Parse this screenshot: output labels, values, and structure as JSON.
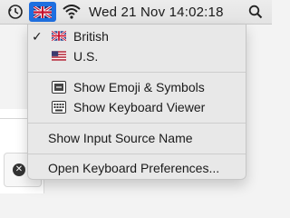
{
  "menubar": {
    "clock_text": "Wed 21 Nov  14:02:18",
    "icons": [
      "time-machine-icon",
      "british-flag-icon",
      "wifi-icon",
      "search-icon"
    ]
  },
  "menu": {
    "sources": [
      {
        "label": "British",
        "checked": true,
        "icon": "british-flag-icon"
      },
      {
        "label": "U.S.",
        "checked": false,
        "icon": "us-flag-icon"
      }
    ],
    "viewers": [
      {
        "label": "Show Emoji & Symbols",
        "icon": "emoji-viewer-icon"
      },
      {
        "label": "Show Keyboard Viewer",
        "icon": "keyboard-viewer-icon"
      }
    ],
    "show_source_name": "Show Input Source Name",
    "open_prefs": "Open Keyboard Preferences..."
  },
  "colors": {
    "menubar_selection": "#1f6fe0",
    "menu_bg": "#e8e8e8"
  }
}
